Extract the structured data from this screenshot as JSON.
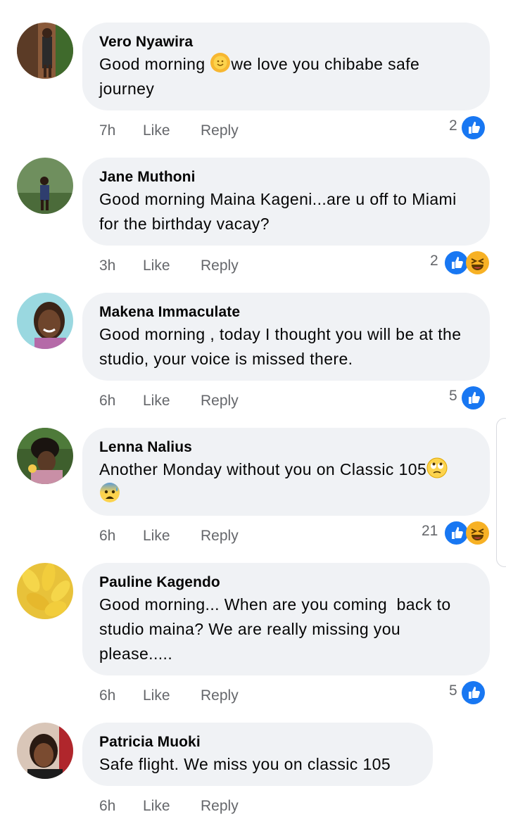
{
  "comments": [
    {
      "name": "Vero Nyawira",
      "text_before": "Good morning ",
      "text_after": "we love you chibabe safe journey",
      "time": "7h",
      "like": "Like",
      "reply": "Reply",
      "reaction_count": "2",
      "reactions": [
        "like-icon"
      ],
      "inline_emoji": "sun-face-emoji"
    },
    {
      "name": "Jane Muthoni",
      "text": "Good morning Maina Kageni...are u off to Miami for the birthday vacay?",
      "time": "3h",
      "like": "Like",
      "reply": "Reply",
      "reaction_count": "2",
      "reactions": [
        "like-icon",
        "laughing-icon"
      ]
    },
    {
      "name": "Makena Immaculate",
      "text": "Good morning , today I thought you will be at the studio, your voice is missed there.",
      "time": "6h",
      "like": "Like",
      "reply": "Reply",
      "reaction_count": "5",
      "reactions": [
        "like-icon"
      ]
    },
    {
      "name": "Lenna Nalius",
      "text": "Another Monday without you on Classic 105",
      "time": "6h",
      "like": "Like",
      "reply": "Reply",
      "reaction_count": "21",
      "reactions": [
        "like-icon",
        "laughing-icon"
      ],
      "inline_emoji": [
        "eye-roll-emoji",
        "anxious-sweat-emoji"
      ]
    },
    {
      "name": "Pauline Kagendo",
      "text": "Good morning... When are you coming  back to studio maina? We are really missing you please.....",
      "time": "6h",
      "like": "Like",
      "reply": "Reply",
      "reaction_count": "5",
      "reactions": [
        "like-icon"
      ]
    },
    {
      "name": "Patricia Muoki",
      "text": "Safe flight. We miss you on classic 105",
      "time": "6h",
      "like": "Like",
      "reply": "Reply"
    }
  ],
  "colors": {
    "bubble": "#f0f2f5",
    "meta": "#65676b",
    "like_blue": "#1877f2",
    "haha_yellow": "#f7b125"
  }
}
